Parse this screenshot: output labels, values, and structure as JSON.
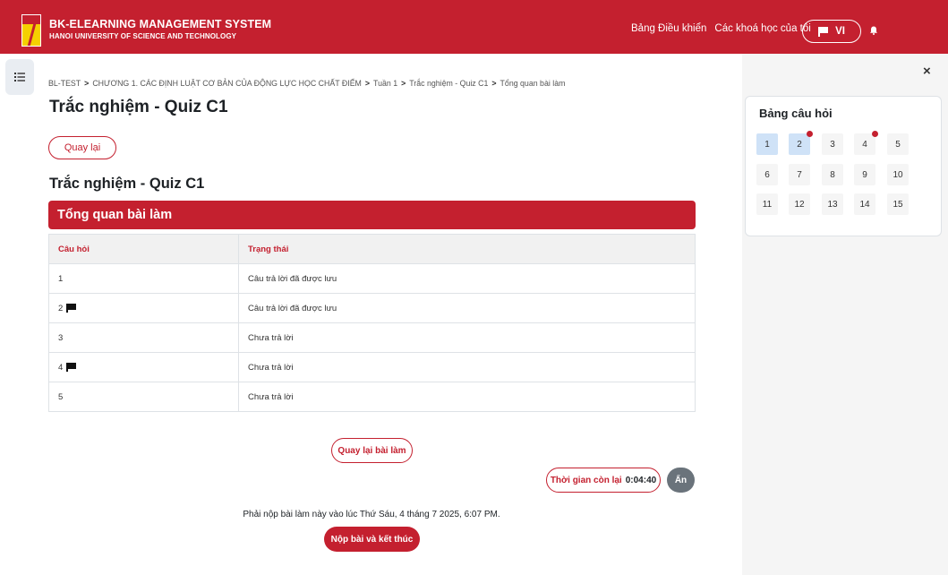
{
  "header": {
    "brand_title": "BK-ELEARNING MANAGEMENT SYSTEM",
    "brand_subtitle": "HANOI UNIVERSITY OF SCIENCE AND TECHNOLOGY",
    "nav_dashboard": "Bảng Điều khiển",
    "nav_my_courses": "Các khoá học của tôi",
    "language": "VI"
  },
  "breadcrumb": {
    "items": [
      "BL-TEST",
      "CHƯƠNG 1. CÁC ĐỊNH LUẬT CƠ BẢN CỦA ĐỘNG LỰC HỌC CHẤT ĐIỂM",
      "Tuần 1",
      "Trắc nghiệm - Quiz C1",
      "Tổng quan bài làm"
    ],
    "separator": ">"
  },
  "page": {
    "title": "Trắc nghiệm - Quiz C1",
    "back_label": "Quay lại",
    "subtitle": "Trắc nghiệm - Quiz C1",
    "summary_heading": "Tổng quan bài làm"
  },
  "table": {
    "headers": [
      "Câu hỏi",
      "Trạng thái"
    ],
    "rows": [
      {
        "question": "1",
        "flagged": false,
        "status": "Câu trả lời đã được lưu"
      },
      {
        "question": "2",
        "flagged": true,
        "status": "Câu trả lời đã được lưu"
      },
      {
        "question": "3",
        "flagged": false,
        "status": "Chưa trả lời"
      },
      {
        "question": "4",
        "flagged": true,
        "status": "Chưa trả lời"
      },
      {
        "question": "5",
        "flagged": false,
        "status": "Chưa trả lời"
      }
    ]
  },
  "actions": {
    "return_label": "Quay lại bài làm",
    "timer_label": "Thời gian còn lại",
    "timer_value": "0:04:40",
    "hide_label": "Ẩn",
    "deadline_text": "Phải nộp bài làm này vào lúc Thứ Sáu, 4 tháng 7 2025, 6:07 PM.",
    "submit_label": "Nộp bài và kết thúc"
  },
  "quiz_nav": {
    "title": "Bảng câu hỏi",
    "close_label": "×",
    "questions": [
      {
        "n": "1",
        "answered": true,
        "flagged": false
      },
      {
        "n": "2",
        "answered": true,
        "flagged": true
      },
      {
        "n": "3",
        "answered": false,
        "flagged": false
      },
      {
        "n": "4",
        "answered": false,
        "flagged": true
      },
      {
        "n": "5",
        "answered": false,
        "flagged": false
      },
      {
        "n": "6",
        "answered": false,
        "flagged": false
      },
      {
        "n": "7",
        "answered": false,
        "flagged": false
      },
      {
        "n": "8",
        "answered": false,
        "flagged": false
      },
      {
        "n": "9",
        "answered": false,
        "flagged": false
      },
      {
        "n": "10",
        "answered": false,
        "flagged": false
      },
      {
        "n": "11",
        "answered": false,
        "flagged": false
      },
      {
        "n": "12",
        "answered": false,
        "flagged": false
      },
      {
        "n": "13",
        "answered": false,
        "flagged": false
      },
      {
        "n": "14",
        "answered": false,
        "flagged": false
      },
      {
        "n": "15",
        "answered": false,
        "flagged": false
      }
    ]
  },
  "colors": {
    "brand_red": "#c4202f",
    "answered_blue": "#cfe2f7",
    "hide_gray": "#6a737b"
  },
  "icons": {
    "drawer_toggle": "list-icon",
    "language_flag": "flag-icon",
    "notification": "bell-icon",
    "row_flag": "flag-icon",
    "logo": "university-logo"
  }
}
